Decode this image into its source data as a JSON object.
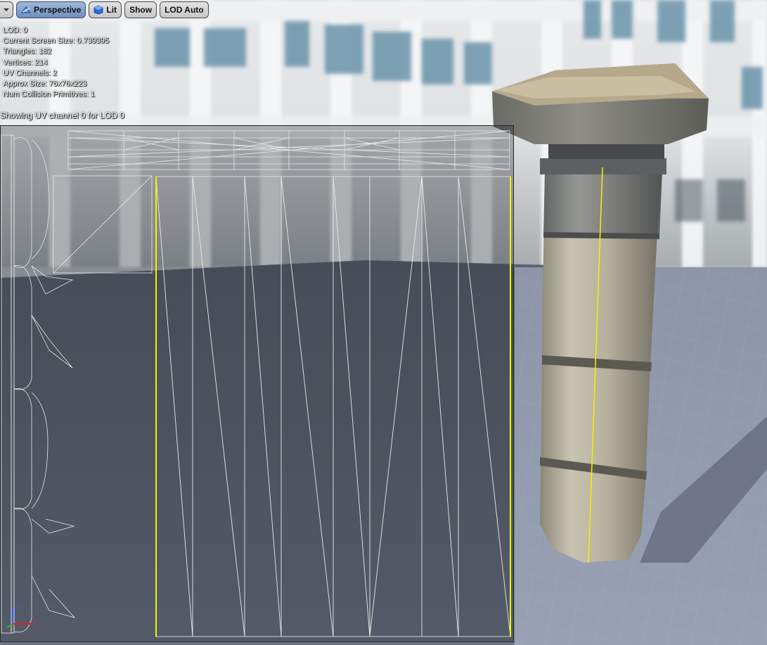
{
  "toolbar": {
    "menu_label": "",
    "perspective_label": "Perspective",
    "lit_label": "Lit",
    "show_label": "Show",
    "lod_label": "LOD Auto"
  },
  "stats": {
    "lod": "LOD:  0",
    "screen_size": "Current Screen Size:  0.739395",
    "triangles": "Triangles:  182",
    "vertices": "Vertices:  214",
    "uv_channels": "UV Channels:  2",
    "approx_size": "Approx Size: 76x76x223",
    "collision": "Num Collision Primitives:  1"
  },
  "uv": {
    "caption": "Showing UV channel 0 for LOD 0"
  },
  "colors": {
    "uv_highlight": "#f2f200",
    "uv_wire": "#e8e8e8",
    "toolbar_active": "#6f8fc0",
    "axis_x": "#e02020",
    "axis_y": "#20c020",
    "axis_z": "#3060ff"
  },
  "icons": {
    "menu": "chevron-down-icon",
    "perspective": "perspective-icon",
    "lit": "lit-cube-icon",
    "axis": "axis-gizmo-icon"
  }
}
